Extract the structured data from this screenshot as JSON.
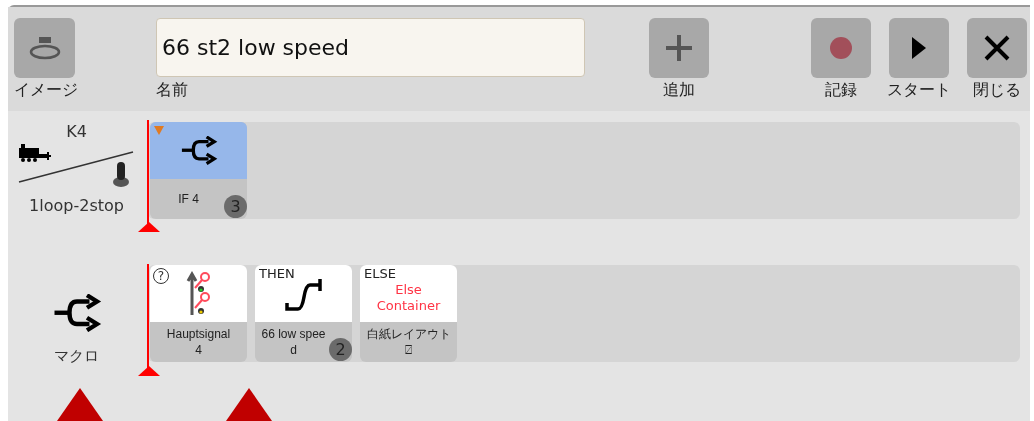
{
  "toolbar": {
    "image_button": {
      "label": "イメージ"
    },
    "name_field": {
      "value": "66 st2 low speed",
      "label": "名前"
    },
    "buttons": [
      {
        "kind": "add",
        "label": "追加"
      },
      {
        "kind": "record",
        "label": "記録"
      },
      {
        "kind": "start",
        "label": "スタート"
      },
      {
        "kind": "close",
        "label": "閉じる"
      }
    ]
  },
  "rows": [
    {
      "kind": "train",
      "title": "K4",
      "subtitle": "1loop-2stop",
      "cards": [
        {
          "kind": "if",
          "label_lines": [
            "IF 4"
          ],
          "badge": "3",
          "selected": true
        }
      ]
    },
    {
      "kind": "macro",
      "subtitle": "マクロ",
      "cards": [
        {
          "kind": "signal",
          "status_mark": "?",
          "label_lines": [
            "Hauptsignal",
            "4"
          ],
          "selected": false
        },
        {
          "kind": "then",
          "tag": "THEN",
          "label_lines": [
            "66 low spee",
            "d"
          ],
          "badge": "2",
          "selected": false
        },
        {
          "kind": "else",
          "tag": "ELSE",
          "note": "Else Container",
          "label_lines": [
            "白紙レイアウト",
            "⍁"
          ],
          "selected": false
        }
      ]
    }
  ]
}
